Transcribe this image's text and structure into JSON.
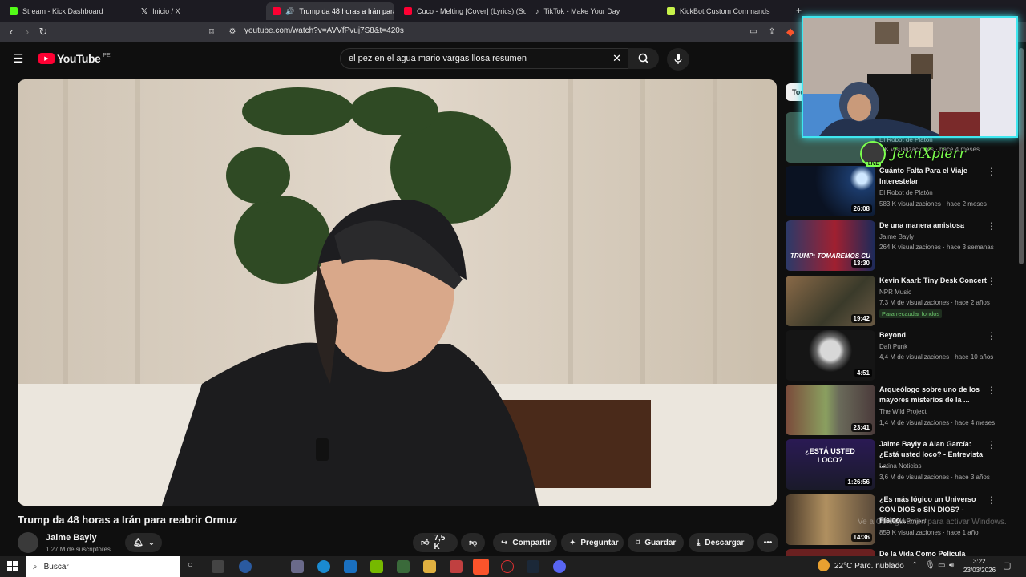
{
  "browser": {
    "tabs": [
      {
        "label": "Stream - Kick Dashboard",
        "color": "#53fc18"
      },
      {
        "label": "Inicio / X",
        "color": "#ffffff"
      },
      {
        "label": "Trump da 48 horas a Irán para",
        "color": "#ff0033"
      },
      {
        "label": "Cuco - Melting [Cover] (Lyrics) (Sub.",
        "color": "#ff0033"
      },
      {
        "label": "TikTok - Make Your Day",
        "color": "#000000"
      },
      {
        "label": "KickBot Custom Commands",
        "color": "#c7f24a"
      }
    ],
    "new_tab": "+",
    "url": "youtube.com/watch?v=AVVfPvuj7S8&t=420s"
  },
  "youtube": {
    "logo": "YouTube",
    "region": "PE",
    "search_query": "el pez en el agua mario vargas llosa resumen",
    "video": {
      "title": "Trump da 48 horas a Irán para reabrir Ormuz",
      "channel": "Jaime Bayly",
      "subscribers": "1,27 M de suscriptores",
      "likes": "7,5 K",
      "share": "Compartir",
      "ask": "Preguntar",
      "save": "Guardar",
      "download": "Descargar"
    },
    "sidebar_filter": "Tod",
    "sidebar": [
      {
        "title": "",
        "channel": "El Robot de Platón",
        "meta": "9 K visualizaciones · hace 4 meses",
        "duration": "23",
        "thumb": "#3a5a50"
      },
      {
        "title": "Cuánto Falta Para el Viaje Interestelar",
        "channel": "El Robot de Platón",
        "meta": "583 K visualizaciones · hace 2 meses",
        "duration": "26:08",
        "thumb": "#0d1a2b"
      },
      {
        "title": "De una manera amistosa",
        "channel": "Jaime Bayly",
        "meta": "264 K visualizaciones · hace 3 semanas",
        "duration": "13:30",
        "thumb": "#1b3a7a",
        "overlay": "TRUMP: TOMAREMOS CU"
      },
      {
        "title": "Kevin Kaarl: Tiny Desk Concert",
        "channel": "NPR Music",
        "meta": "7,3 M de visualizaciones · hace 2 años",
        "duration": "19:42",
        "thumb": "#6a5a44",
        "badge": "Para recaudar fondos"
      },
      {
        "title": "Beyond",
        "channel": "Daft Punk",
        "meta": "4,4 M de visualizaciones · hace 10 años",
        "duration": "4:51",
        "thumb": "#151515"
      },
      {
        "title": "Arqueólogo sobre uno de los mayores misterios de la ...",
        "channel": "The Wild Project",
        "meta": "1,4 M de visualizaciones · hace 4 meses",
        "duration": "23:41",
        "thumb": "#6a7a54"
      },
      {
        "title": "Jaime Bayly a Alan García: ¿Está usted loco? - Entrevista ...",
        "channel": "Latina Noticias",
        "meta": "3,6 M de visualizaciones · hace 3 años",
        "duration": "1:26:56",
        "thumb": "#241a44",
        "overlay": "¿ESTÁ USTED LOCO?"
      },
      {
        "title": "¿Es más lógico un Universo CON DIOS o SIN DIOS? - Físico...",
        "channel": "The Wild Project",
        "meta": "859 K visualizaciones · hace 1 año",
        "duration": "14:36",
        "thumb": "#5a4a3a"
      },
      {
        "title": "De la Vida Como Película",
        "channel": "",
        "meta": "",
        "duration": "",
        "thumb": "#6a2020"
      }
    ]
  },
  "overlay": {
    "streamer_name": "JeanXpierr",
    "live_label": "LIVE",
    "watermark": "Ve a Configuración para activar Windows."
  },
  "taskbar": {
    "search_label": "Buscar",
    "weather": "22°C  Parc. nublado",
    "time": "3:22",
    "date": "23/03/2026"
  }
}
